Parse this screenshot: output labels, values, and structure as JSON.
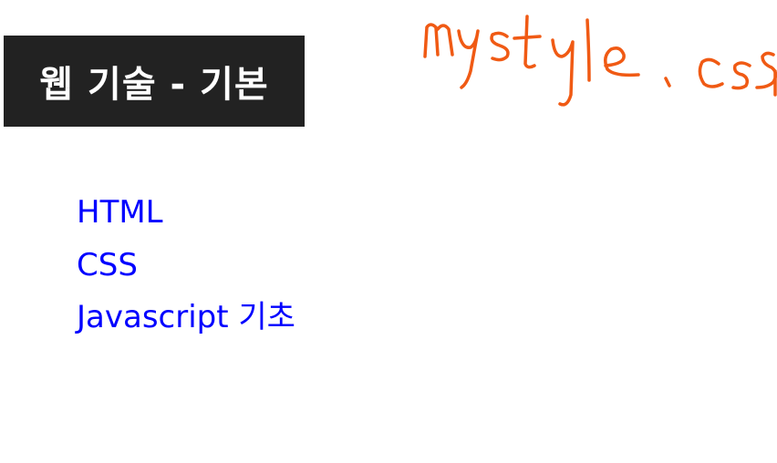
{
  "header": {
    "title": "웹 기술 - 기본"
  },
  "nav": {
    "items": [
      {
        "label": "HTML"
      },
      {
        "label": "CSS"
      },
      {
        "label": "Javascript 기초"
      }
    ]
  },
  "annotation": {
    "text": "mystyle.css",
    "color": "#f05a14",
    "style": "handwritten"
  },
  "colors": {
    "title_bg": "#222222",
    "title_text": "#ffffff",
    "link": "#0000ff",
    "page_bg": "#ffffff"
  }
}
